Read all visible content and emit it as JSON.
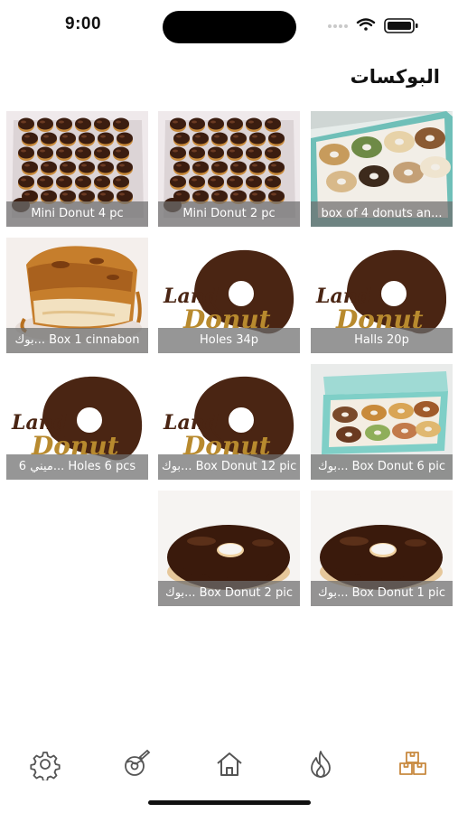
{
  "status_bar": {
    "time": "9:00"
  },
  "page": {
    "title": "البوكسات"
  },
  "products": [
    {
      "name": "box of 4 donuts an...",
      "art": "donut-box-photo"
    },
    {
      "name": "Mini Donut 2 pc",
      "art": "mini-donuts-photo"
    },
    {
      "name": "Mini Donut 4 pc",
      "art": "mini-donuts-photo"
    },
    {
      "name": "Halls 20p",
      "art": "land-donut-logo"
    },
    {
      "name": "Holes 34p",
      "art": "land-donut-logo"
    },
    {
      "name": "بوك... Box 1 cinnabon",
      "art": "cinnabon-photo"
    },
    {
      "name": "بوك... Box Donut 6 pic",
      "art": "teal-box-photo"
    },
    {
      "name": "بوك... Box Donut 12 pic",
      "art": "land-donut-logo"
    },
    {
      "name": "ميني 6... Holes 6 pcs",
      "art": "land-donut-logo"
    },
    {
      "name": "بوك... Box Donut 1 pic",
      "art": "chocolate-donut-photo"
    },
    {
      "name": "بوك... Box Donut 2 pic",
      "art": "chocolate-donut-photo"
    }
  ],
  "logo": {
    "line1": "Land",
    "line2": "Donut"
  },
  "tab_bar": {
    "tabs": [
      {
        "icon": "gear-icon"
      },
      {
        "icon": "donut-pen-icon"
      },
      {
        "icon": "home-icon"
      },
      {
        "icon": "flame-icon"
      },
      {
        "icon": "boxes-icon",
        "active": true
      }
    ]
  },
  "colors": {
    "accent": "#c8893f",
    "logo_brown": "#4a2513",
    "logo_gold": "#b88a2e",
    "caption_bg": "#6e6e6e"
  }
}
